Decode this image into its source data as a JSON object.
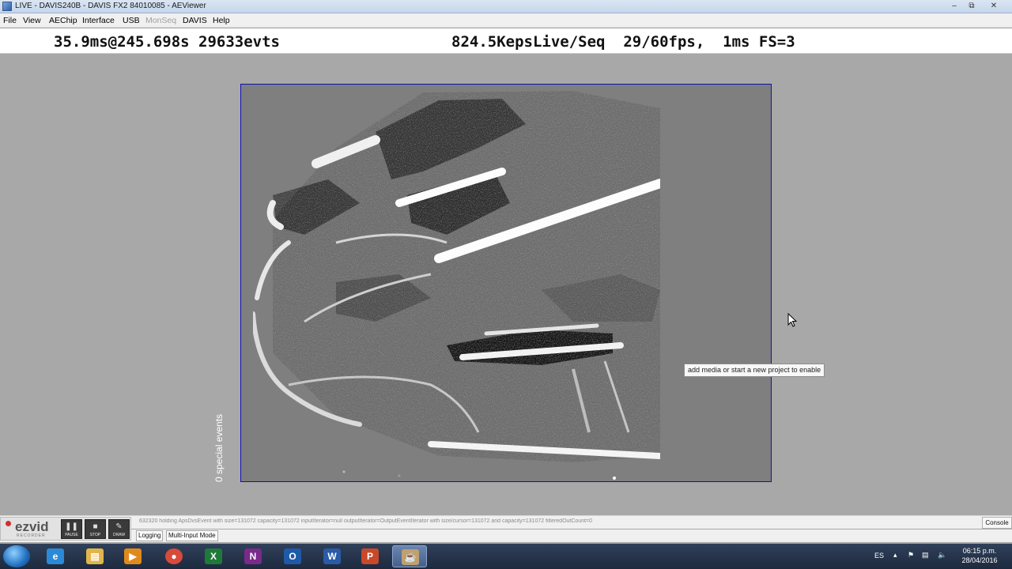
{
  "window": {
    "title": "LIVE - DAVIS240B - DAVIS FX2 84010085 - AEViewer",
    "controls": [
      "–",
      "⧉",
      "✕"
    ]
  },
  "menu": {
    "items": [
      {
        "label": "File",
        "enabled": true
      },
      {
        "label": "View",
        "enabled": true
      },
      {
        "label": "AEChip",
        "enabled": true
      },
      {
        "label": "Interface",
        "enabled": true
      },
      {
        "label": "USB",
        "enabled": true
      },
      {
        "label": "MonSeq",
        "enabled": false
      },
      {
        "label": "DAVIS",
        "enabled": true
      },
      {
        "label": "Help",
        "enabled": true
      }
    ]
  },
  "status": {
    "left": "35.9ms@245.698s 29633evts",
    "right": "824.5KepsLive/Seq  29/60fps,  1ms FS=3"
  },
  "viewer": {
    "special_events": "0 special events",
    "border_color": "#1010b0",
    "background_gray": "#7f7f7f"
  },
  "tooltip": {
    "text": "add media or start a new project to enable"
  },
  "log": {
    "text": "632320 holding ApsDvsEvent with size=131072 capacity=131072 inputIterator=null outputIterator=OutputEventIterator with size/cursor=131072 and capacity=131072 filteredOutCount=0",
    "console_label": "Console"
  },
  "modes": {
    "logging_label": "Logging",
    "multi_input_label": "Multi-Input Mode"
  },
  "ezvid": {
    "logo": "ezvid",
    "subtitle": "RECORDER",
    "buttons": [
      {
        "label": "PAUSE",
        "icon": "pause-icon"
      },
      {
        "label": "STOP",
        "icon": "stop-icon"
      },
      {
        "label": "DRAW",
        "icon": "draw-icon"
      }
    ]
  },
  "taskbar": {
    "apps": [
      {
        "name": "internet-explorer",
        "glyph": "e",
        "color": "#2a8ad8"
      },
      {
        "name": "file-explorer",
        "glyph": "▤",
        "color": "#e1b54a"
      },
      {
        "name": "media-player",
        "glyph": "▶",
        "color": "#e08a1c"
      },
      {
        "name": "chrome",
        "glyph": "●",
        "color": "#d84a3a"
      },
      {
        "name": "excel",
        "glyph": "X",
        "color": "#1f7a3a"
      },
      {
        "name": "onenote",
        "glyph": "N",
        "color": "#7a2a8a"
      },
      {
        "name": "outlook",
        "glyph": "O",
        "color": "#1e5aa8"
      },
      {
        "name": "word",
        "glyph": "W",
        "color": "#2a5aa8"
      },
      {
        "name": "powerpoint",
        "glyph": "P",
        "color": "#c8482a"
      },
      {
        "name": "java",
        "glyph": "☕",
        "color": "#c0a070"
      }
    ],
    "language": "ES",
    "time": "06:15 p.m.",
    "date": "28/04/2016"
  }
}
